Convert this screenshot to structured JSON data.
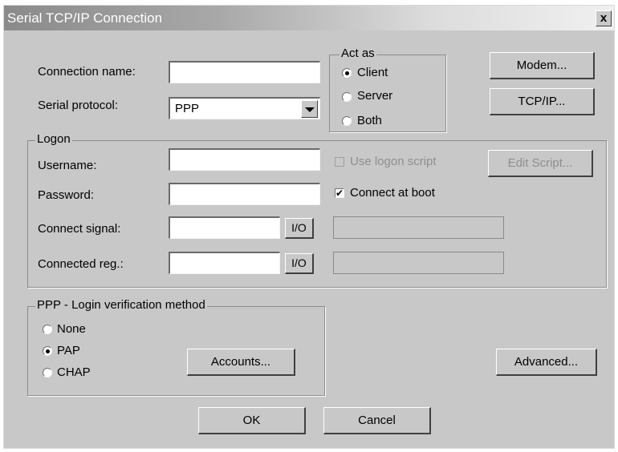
{
  "window": {
    "title": "Serial TCP/IP Connection",
    "close_label": "x"
  },
  "connection": {
    "name_label": "Connection name:",
    "name_value": "",
    "protocol_label": "Serial protocol:",
    "protocol_value": "PPP"
  },
  "act_as": {
    "legend": "Act as",
    "options": [
      {
        "label": "Client",
        "selected": true
      },
      {
        "label": "Server",
        "selected": false
      },
      {
        "label": "Both",
        "selected": false
      }
    ]
  },
  "buttons": {
    "modem": "Modem...",
    "tcpip": "TCP/IP...",
    "edit_script": "Edit Script...",
    "io": "I/O",
    "accounts": "Accounts...",
    "advanced": "Advanced...",
    "ok": "OK",
    "cancel": "Cancel"
  },
  "logon": {
    "legend": "Logon",
    "username_label": "Username:",
    "username_value": "",
    "password_label": "Password:",
    "password_value": "",
    "connect_signal_label": "Connect signal:",
    "connected_reg_label": "Connected reg.:",
    "use_logon_script": {
      "label": "Use logon script",
      "checked": false,
      "enabled": false
    },
    "connect_at_boot": {
      "label": "Connect at boot",
      "checked": true,
      "enabled": true
    }
  },
  "ppp_login": {
    "legend": "PPP - Login verification method",
    "options": [
      {
        "label": "None",
        "selected": false
      },
      {
        "label": "PAP",
        "selected": true
      },
      {
        "label": "CHAP",
        "selected": false
      }
    ]
  }
}
